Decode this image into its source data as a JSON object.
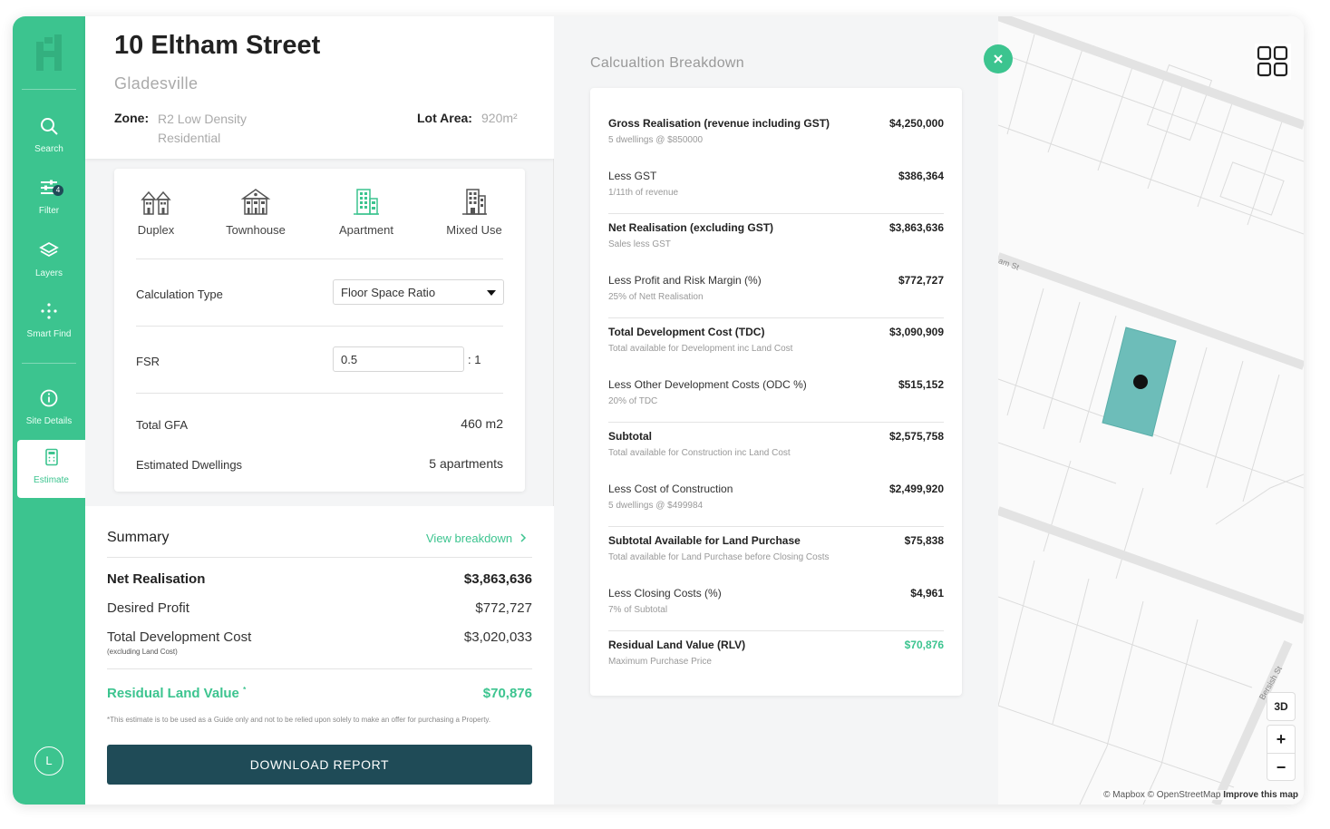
{
  "sidebar": {
    "items": [
      {
        "label": "Search",
        "icon": "search-icon"
      },
      {
        "label": "Filter",
        "icon": "filter-icon",
        "badge": "4"
      },
      {
        "label": "Layers",
        "icon": "layers-icon"
      },
      {
        "label": "Smart Find",
        "icon": "smart-find-icon"
      },
      {
        "label": "Site Details",
        "icon": "info-icon"
      },
      {
        "label": "Estimate",
        "icon": "calculator-icon",
        "active": true
      }
    ],
    "avatar": "L"
  },
  "property": {
    "title": "10 Eltham Street",
    "suburb": "Gladesville",
    "zone_label": "Zone:",
    "zone_value": "R2 Low Density Residential",
    "lot_label": "Lot Area:",
    "lot_value": "920m²"
  },
  "estimate": {
    "types": [
      {
        "label": "Duplex",
        "icon": "duplex-icon"
      },
      {
        "label": "Townhouse",
        "icon": "townhouse-icon"
      },
      {
        "label": "Apartment",
        "icon": "apartment-icon",
        "selected": true
      },
      {
        "label": "Mixed Use",
        "icon": "mixed-use-icon"
      }
    ],
    "calc_type_label": "Calculation Type",
    "calc_type_value": "Floor Space Ratio",
    "fsr_label": "FSR",
    "fsr_value": "0.5",
    "fsr_suffix": ": 1",
    "gfa_label": "Total GFA",
    "gfa_value": "460 m2",
    "dwellings_label": "Estimated Dwellings",
    "dwellings_value": "5 apartments"
  },
  "summary": {
    "title": "Summary",
    "view_link": "View breakdown",
    "net_label": "Net Realisation",
    "net_value": "$3,863,636",
    "profit_label": "Desired Profit",
    "profit_value": "$772,727",
    "tdc_label": "Total Development Cost",
    "tdc_sub": "(excluding Land Cost)",
    "tdc_value": "$3,020,033",
    "rlv_label": "Residual Land Value",
    "rlv_mark": "*",
    "rlv_value": "$70,876",
    "disclaimer": "*This estimate is to be used as a Guide only and not to be relied upon solely to make an offer for purchasing a Property.",
    "download": "DOWNLOAD REPORT"
  },
  "breakdown": {
    "title": "Calcualtion Breakdown",
    "rows": [
      {
        "label": "Gross Realisation (revenue including GST)",
        "sub": "5 dwellings @ $850000",
        "value": "$4,250,000",
        "bold": true
      },
      {
        "label": "Less GST",
        "sub": "1/11th of revenue",
        "value": "$386,364",
        "bold": false
      },
      {
        "label": "Net Realisation (excluding GST)",
        "sub": "Sales less GST",
        "value": "$3,863,636",
        "bold": true
      },
      {
        "label": "Less Profit and Risk Margin (%)",
        "sub": "25% of Nett Realisation",
        "value": "$772,727",
        "bold": false
      },
      {
        "label": "Total Development Cost (TDC)",
        "sub": "Total available for Development inc Land Cost",
        "value": "$3,090,909",
        "bold": true
      },
      {
        "label": "Less Other Development Costs (ODC %)",
        "sub": "20% of TDC",
        "value": "$515,152",
        "bold": false
      },
      {
        "label": "Subtotal",
        "sub": "Total available for Construction inc Land Cost",
        "value": "$2,575,758",
        "bold": true
      },
      {
        "label": "Less Cost of Construction",
        "sub": "5 dwellings @ $499984",
        "value": "$2,499,920",
        "bold": false
      },
      {
        "label": "Subtotal Available for Land Purchase",
        "sub": "Total available for Land Purchase before Closing Costs",
        "value": "$75,838",
        "bold": true
      },
      {
        "label": "Less Closing Costs (%)",
        "sub": "7% of Subtotal",
        "value": "$4,961",
        "bold": false
      },
      {
        "label": "Residual Land Value (RLV)",
        "sub": "Maximum Purchase Price",
        "value": "$70,876",
        "bold": true,
        "green": true
      }
    ]
  },
  "map": {
    "street_1": "am St",
    "street_2": "Bersish St",
    "btn_3d": "3D",
    "zoom_in": "+",
    "zoom_out": "−",
    "attrib_1": "© Mapbox © OpenStreetMap",
    "attrib_2": "Improve this map"
  },
  "colors": {
    "accent": "#3cc48f",
    "dark": "#1f4b57",
    "parcel": "#6dbdb9"
  }
}
